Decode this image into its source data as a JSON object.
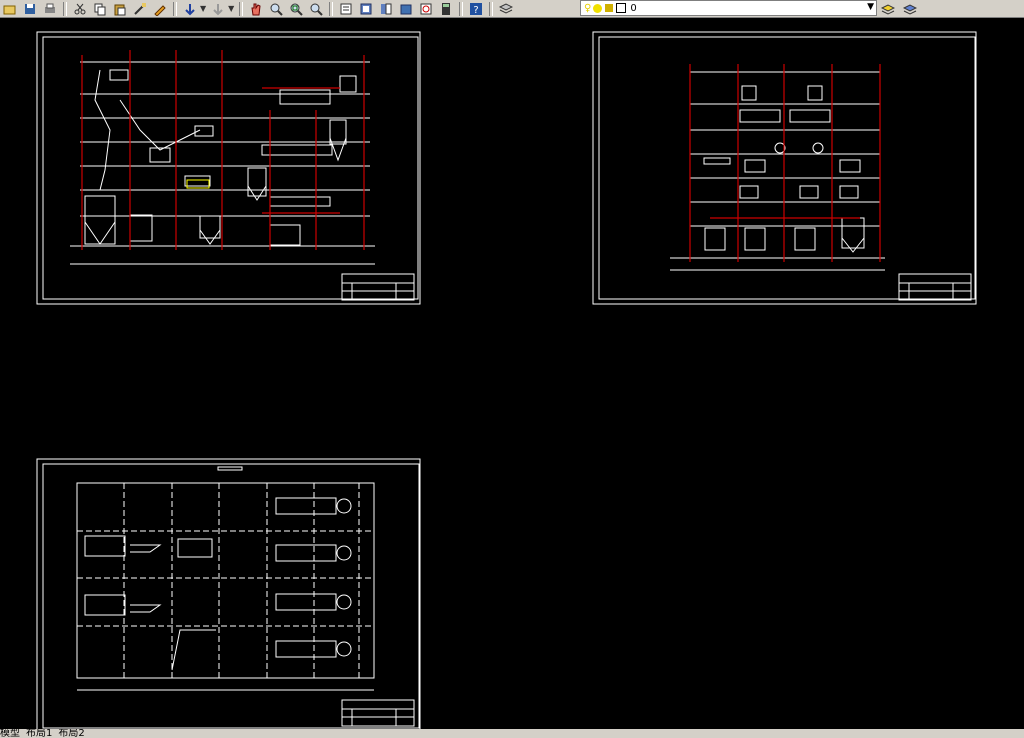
{
  "toolbar": {
    "layer_value": "0"
  },
  "layout_tabs": [
    "模型",
    "布局1",
    "布局2"
  ],
  "colors": {
    "background": "#000000",
    "toolbar": "#d4d0c8",
    "lines": "#ffffff",
    "columns": "#cc0000",
    "accent": "#ffff00"
  }
}
